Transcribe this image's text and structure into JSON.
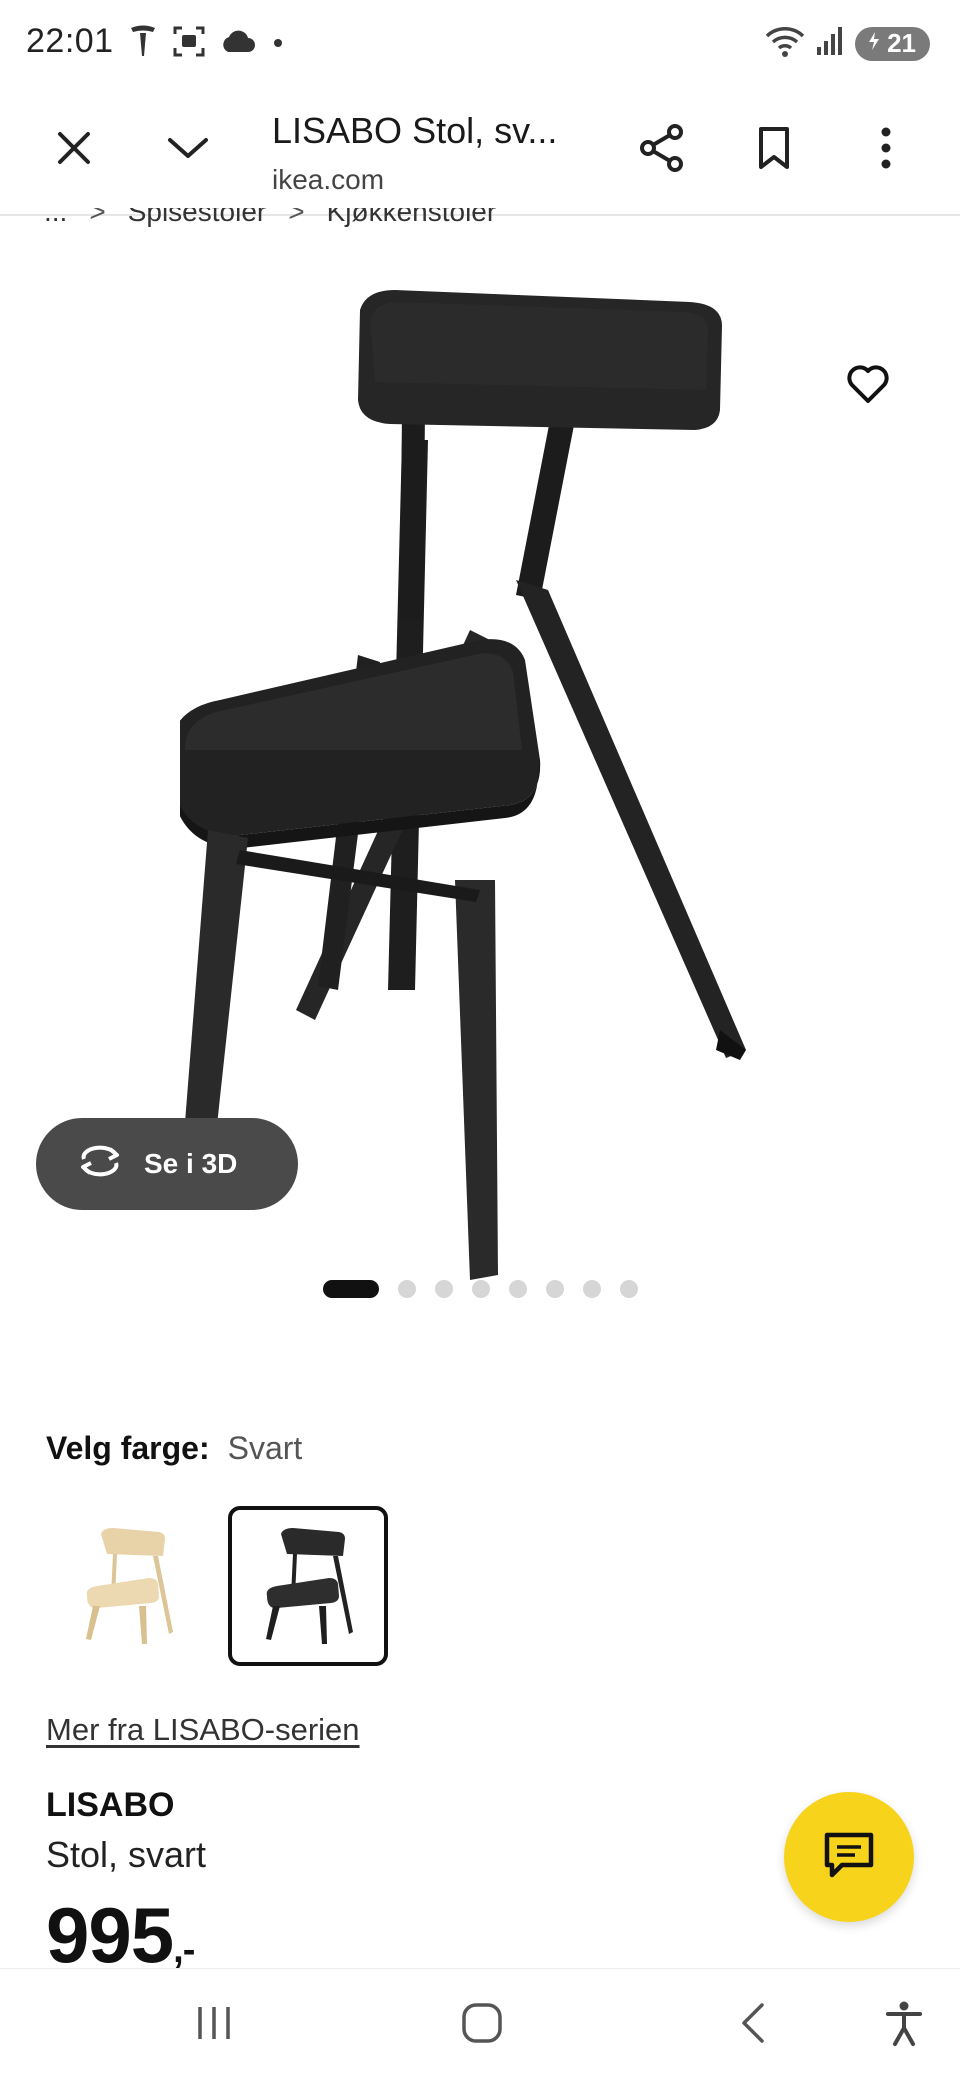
{
  "status_bar": {
    "time": "22:01",
    "battery": "21",
    "left_icons": [
      "tesla-icon",
      "screenshot-icon",
      "cloud-icon",
      "dot-icon"
    ],
    "right_icons": [
      "wifi-icon",
      "signal-icon",
      "battery-icon"
    ]
  },
  "toolbar": {
    "title": "LISABO Stol, sv...",
    "url": "ikea.com"
  },
  "breadcrumb": {
    "items": [
      "...",
      "Spisestoler",
      "Kjøkkenstoler"
    ],
    "separator": ">"
  },
  "gallery": {
    "view_3d_label": "Se i 3D",
    "image_count": 8,
    "active_index": 0
  },
  "color": {
    "label": "Velg farge:",
    "value": "Svart",
    "options": [
      {
        "name": "bjørk",
        "hex": "#e8d3a8"
      },
      {
        "name": "Svart",
        "hex": "#2a2a2a"
      }
    ]
  },
  "series_link": "Mer fra LISABO-serien",
  "product": {
    "name": "LISABO",
    "description": "Stol, svart",
    "price": "995",
    "price_suffix": ",-"
  },
  "colors": {
    "chat_fab": "#f7d31b",
    "button_3d": "#4a4a4a"
  }
}
